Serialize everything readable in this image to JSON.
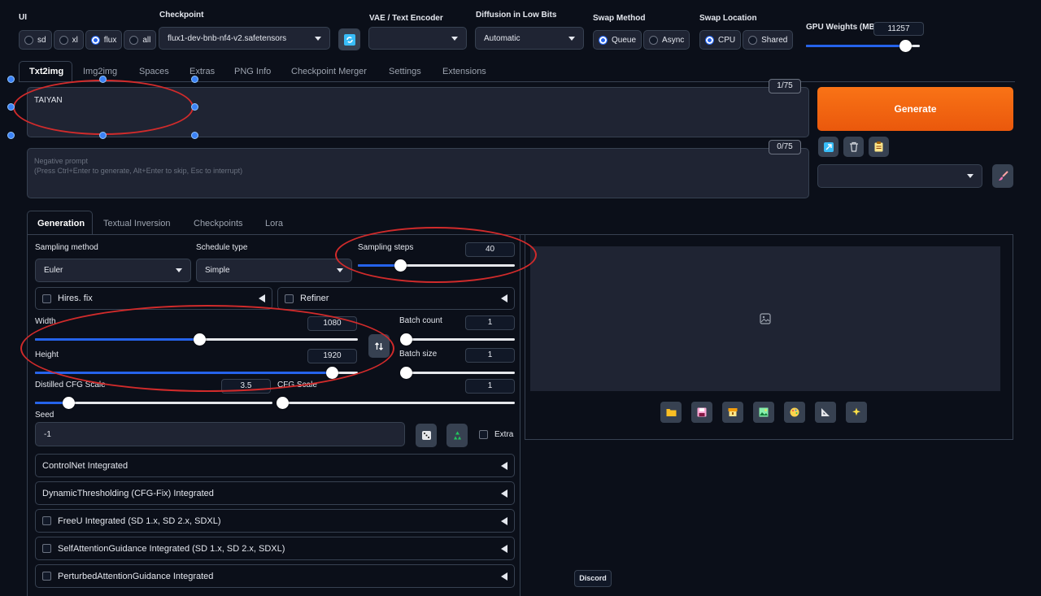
{
  "top": {
    "ui_label": "UI",
    "ui_options": [
      "sd",
      "xl",
      "flux",
      "all"
    ],
    "ui_selected": "flux",
    "checkpoint_label": "Checkpoint",
    "checkpoint_value": "flux1-dev-bnb-nf4-v2.safetensors",
    "vae_label": "VAE / Text Encoder",
    "vae_value": "",
    "diffusion_label": "Diffusion in Low Bits",
    "diffusion_value": "Automatic",
    "swap_method_label": "Swap Method",
    "swap_method_options": [
      "Queue",
      "Async"
    ],
    "swap_method_selected": "Queue",
    "swap_location_label": "Swap Location",
    "swap_location_options": [
      "CPU",
      "Shared"
    ],
    "swap_location_selected": "CPU",
    "gpu_weights_label": "GPU Weights (MB)",
    "gpu_weights_value": "11257",
    "gpu_weights_fraction": 0.87
  },
  "tabs": [
    "Txt2img",
    "Img2img",
    "Spaces",
    "Extras",
    "PNG Info",
    "Checkpoint Merger",
    "Settings",
    "Extensions"
  ],
  "active_tab": "Txt2img",
  "prompt": {
    "value": "TAIYAN",
    "counter": "1/75"
  },
  "negative_prompt": {
    "placeholder_line1": "Negative prompt",
    "placeholder_line2": "(Press Ctrl+Enter to generate, Alt+Enter to skip, Esc to interrupt)",
    "counter": "0/75"
  },
  "generate_label": "Generate",
  "subtabs": [
    "Generation",
    "Textual Inversion",
    "Checkpoints",
    "Lora"
  ],
  "active_subtab": "Generation",
  "generation": {
    "sampling_method_label": "Sampling method",
    "sampling_method_value": "Euler",
    "schedule_type_label": "Schedule type",
    "schedule_type_value": "Simple",
    "sampling_steps_label": "Sampling steps",
    "sampling_steps_value": "40",
    "sampling_steps_fraction": 0.27,
    "hires_fix_label": "Hires. fix",
    "refiner_label": "Refiner",
    "width_label": "Width",
    "width_value": "1080",
    "width_fraction": 0.51,
    "height_label": "Height",
    "height_value": "1920",
    "height_fraction": 0.92,
    "batch_count_label": "Batch count",
    "batch_count_value": "1",
    "batch_size_label": "Batch size",
    "batch_size_value": "1",
    "distilled_cfg_label": "Distilled CFG Scale",
    "distilled_cfg_value": "3.5",
    "distilled_cfg_fraction": 0.14,
    "cfg_label": "CFG Scale",
    "cfg_value": "1",
    "cfg_fraction": 0.02,
    "seed_label": "Seed",
    "seed_value": "-1",
    "extra_label": "Extra"
  },
  "accordions": [
    "ControlNet Integrated",
    "DynamicThresholding (CFG-Fix) Integrated",
    "FreeU Integrated (SD 1.x, SD 2.x, SDXL)",
    "SelfAttentionGuidance Integrated (SD 1.x, SD 2.x, SDXL)",
    "PerturbedAttentionGuidance Integrated"
  ],
  "discord_label": "Discord",
  "colors": {
    "accent": "#2563eb",
    "generate": "#f97316",
    "annotation": "#d12b2b",
    "background": "#0b0f19"
  }
}
